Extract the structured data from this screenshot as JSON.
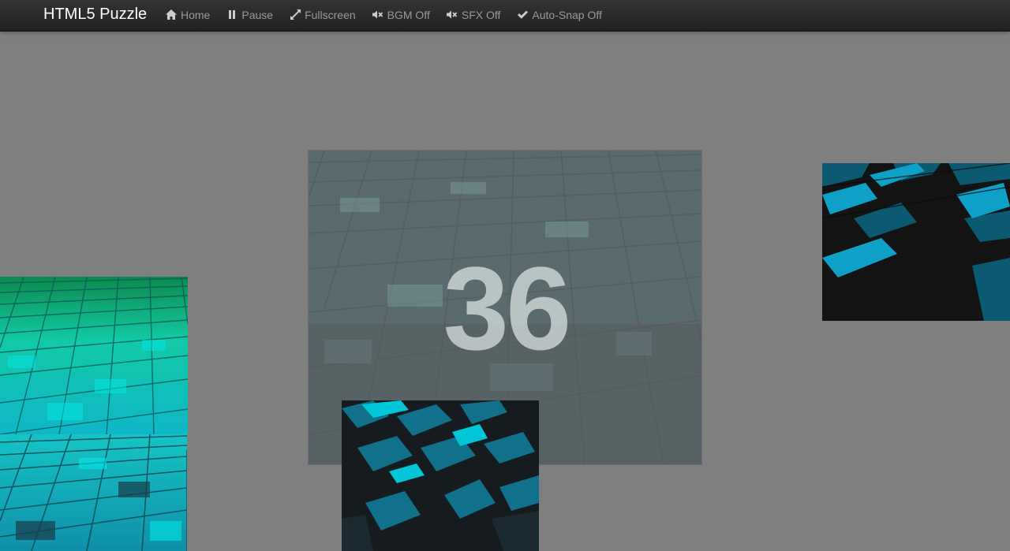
{
  "navbar": {
    "brand": "HTML5 Puzzle",
    "items": [
      {
        "label": "Home",
        "icon": "home-icon"
      },
      {
        "label": "Pause",
        "icon": "pause-icon"
      },
      {
        "label": "Fullscreen",
        "icon": "fullscreen-icon"
      },
      {
        "label": "BGM Off",
        "icon": "volume-off-icon"
      },
      {
        "label": "SFX Off",
        "icon": "volume-off-icon"
      },
      {
        "label": "Auto-Snap Off",
        "icon": "check-icon"
      }
    ]
  },
  "game": {
    "countdown": "36"
  },
  "colors": {
    "navbar_bg": "#2a2a2a",
    "stage_bg": "#7f7f7f",
    "tile_teal": "#1fb3c7",
    "tile_green": "#1ec98a",
    "tile_dark": "#151515"
  }
}
